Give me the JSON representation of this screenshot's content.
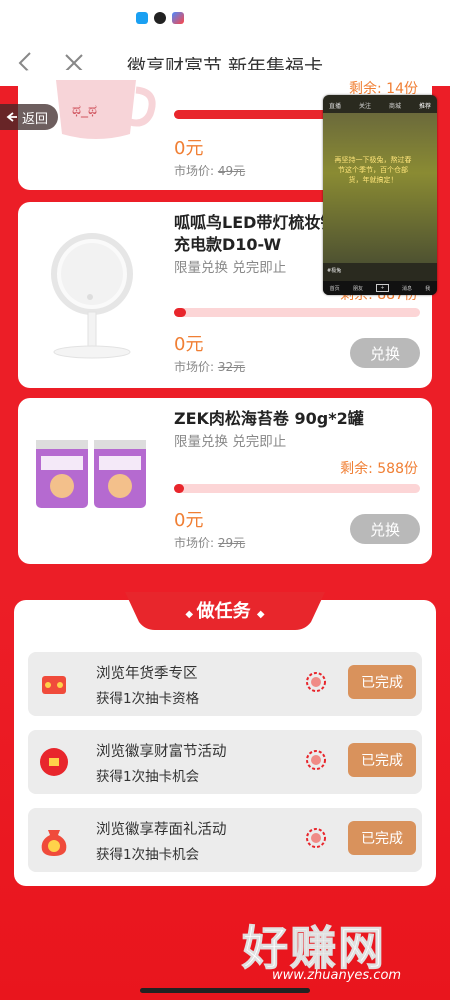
{
  "nav": {
    "title": "徽享财富节 新年集福卡"
  },
  "return_label": "返回",
  "top_card": {
    "price": "0元",
    "market_label": "市场价:",
    "market_value": "49元",
    "remain": "剩余: 14份"
  },
  "products": [
    {
      "title_line1": "呱呱鸟LED带灯梳妆镜",
      "title_line2": "充电款D10-W",
      "sub": "限量兑换 兑完即止",
      "remain": "剩余: 887份",
      "progress": 0.05,
      "price": "0元",
      "market_label": "市场价:",
      "market_value": "32元",
      "button": "兑换"
    },
    {
      "title_line1": "ZEK肉松海苔卷 90g*2罐",
      "title_line2": "",
      "sub": "限量兑换 兑完即止",
      "remain": "剩余: 588份",
      "progress": 0.02,
      "price": "0元",
      "market_label": "市场价:",
      "market_value": "29元",
      "button": "兑换"
    }
  ],
  "video": {
    "tabs": [
      "直播",
      "关注",
      "商城",
      "推荐"
    ],
    "caption": "再坚持一下极兔，熬过春节这个季节，百个仓部货，年就搞定！",
    "desc": "#极兔",
    "bottom": [
      "首页",
      "朋友",
      "消息",
      "我"
    ]
  },
  "tasks_title": "做任务",
  "tasks": [
    {
      "title": "浏览年货季专区",
      "sub": "获得1次抽卡资格",
      "button": "已完成"
    },
    {
      "title": "浏览徽享财富节活动",
      "sub": "获得1次抽卡机会",
      "button": "已完成"
    },
    {
      "title": "浏览徽享荐面礼活动",
      "sub": "获得1次抽卡机会",
      "button": "已完成"
    }
  ],
  "watermark": {
    "text": "好赚网",
    "url": "www.zhuanyes.com"
  },
  "colors": {
    "brand_red": "#ec1e27",
    "accent_orange": "#f07f34",
    "done_button": "#d9925c"
  }
}
